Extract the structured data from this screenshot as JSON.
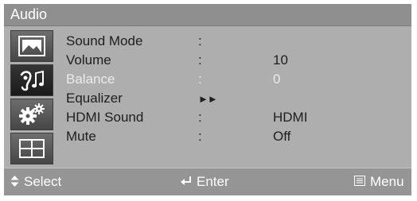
{
  "window": {
    "title": "Audio"
  },
  "icons": [
    "picture-icon",
    "sound-icon",
    "setup-gears-icon",
    "grid-layout-icon"
  ],
  "menu": {
    "items": [
      {
        "label": "Sound Mode",
        "sep": ":",
        "value": ""
      },
      {
        "label": "Volume",
        "sep": ":",
        "value": "10"
      },
      {
        "label": "Balance",
        "sep": ":",
        "value": "0",
        "disabled": true
      },
      {
        "label": "Equalizer",
        "sep": "►►",
        "value": ""
      },
      {
        "label": "HDMI Sound",
        "sep": ":",
        "value": "HDMI"
      },
      {
        "label": "Mute",
        "sep": ":",
        "value": "Off"
      }
    ]
  },
  "footer": {
    "select_label": "Select",
    "enter_label": "Enter",
    "menu_label": "Menu"
  },
  "colors": {
    "panel": "#b0b0b0",
    "title_bar": "#8f8f8f",
    "footer": "#959595",
    "disabled_text": "#ebebeb"
  }
}
